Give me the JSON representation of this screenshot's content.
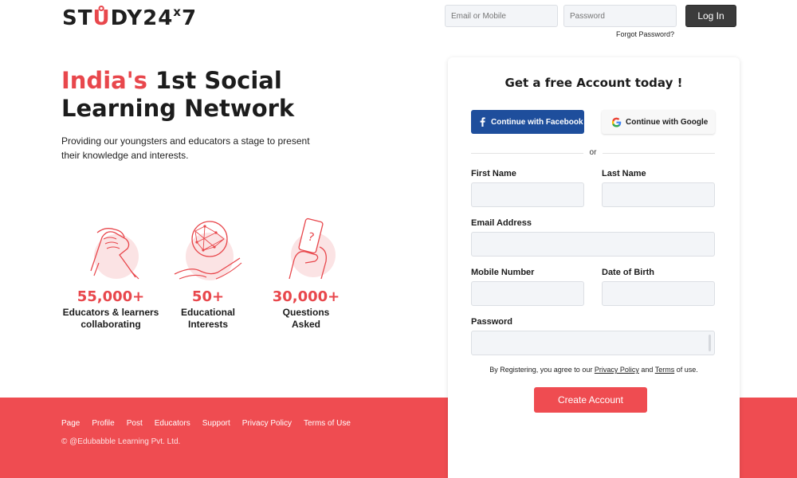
{
  "brand": {
    "logo_start": "ST",
    "logo_accent": "Ů",
    "logo_mid": "DY24",
    "logo_sup": "x",
    "logo_end": "7",
    "accent_color": "#e8474c"
  },
  "header": {
    "email_placeholder": "Email or Mobile",
    "password_placeholder": "Password",
    "login_label": "Log In",
    "forgot_label": "Forgot Password?"
  },
  "hero": {
    "title_red": "India's",
    "title_rest": " 1st Social",
    "title_line2": "Learning Network",
    "description": "Providing our youngsters and educators a stage to present their knowledge and interests."
  },
  "stats": [
    {
      "value": "55,000+",
      "label_line1": "Educators & learners",
      "label_line2": "collaborating",
      "icon": "handshake-icon"
    },
    {
      "value": "50+",
      "label_line1": "Educational",
      "label_line2": "Interests",
      "icon": "globe-hands-icon"
    },
    {
      "value": "30,000+",
      "label_line1": "Questions",
      "label_line2": "Asked",
      "icon": "phone-question-icon"
    }
  ],
  "signup": {
    "title": "Get a free Account today !",
    "facebook_label": "Continue with Facebook",
    "google_label": "Continue with Google",
    "or_text": "or",
    "first_name_label": "First Name",
    "last_name_label": "Last Name",
    "email_label": "Email Address",
    "mobile_label": "Mobile Number",
    "dob_label": "Date of Birth",
    "password_label": "Password",
    "agree_prefix": "By Registering, you agree to our ",
    "privacy_link": "Privacy Policy",
    "agree_and": " and ",
    "terms_link": "Terms",
    "agree_suffix": " of use.",
    "create_label": "Create Account"
  },
  "footer": {
    "links": [
      "Page",
      "Profile",
      "Post",
      "Educators",
      "Support",
      "Privacy Policy",
      "Terms of Use"
    ],
    "copyright": "© @Edubabble Learning Pvt. Ltd."
  }
}
